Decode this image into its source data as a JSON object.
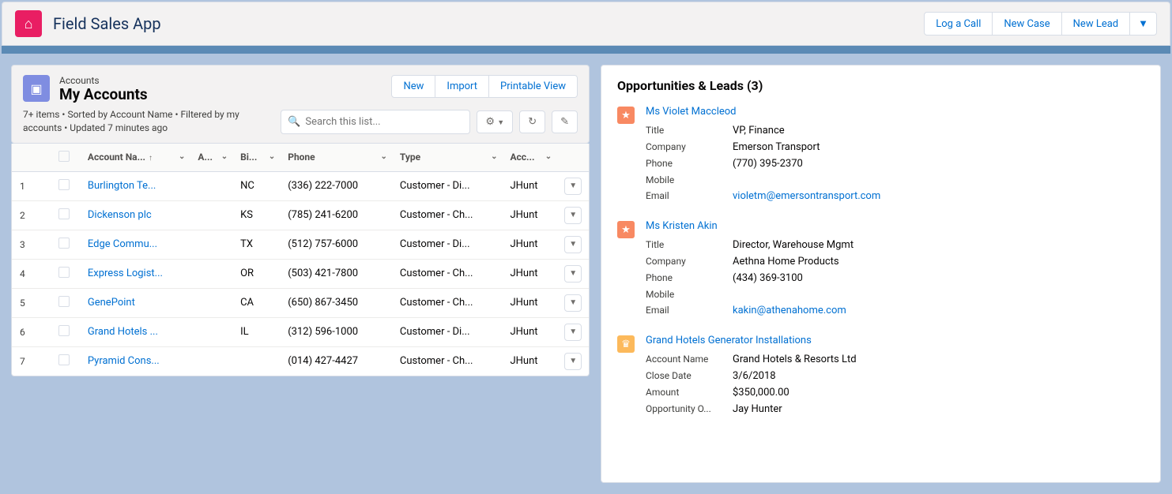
{
  "header": {
    "app_title": "Field Sales App",
    "actions": [
      "Log a Call",
      "New Case",
      "New Lead"
    ]
  },
  "accounts": {
    "object_label": "Accounts",
    "view_title": "My Accounts",
    "meta": "7+ items • Sorted by Account Name • Filtered by my accounts • Updated 7 minutes ago",
    "actions": [
      "New",
      "Import",
      "Printable View"
    ],
    "search_placeholder": "Search this list...",
    "columns": [
      "Account Na...",
      "A...",
      "Bi...",
      "Phone",
      "Type",
      "Acc..."
    ],
    "rows": [
      {
        "n": "1",
        "name": "Burlington Te...",
        "a": "",
        "state": "NC",
        "phone": "(336) 222-7000",
        "type": "Customer - Di...",
        "owner": "JHunt"
      },
      {
        "n": "2",
        "name": "Dickenson plc",
        "a": "",
        "state": "KS",
        "phone": "(785) 241-6200",
        "type": "Customer - Ch...",
        "owner": "JHunt"
      },
      {
        "n": "3",
        "name": "Edge Commu...",
        "a": "",
        "state": "TX",
        "phone": "(512) 757-6000",
        "type": "Customer - Di...",
        "owner": "JHunt"
      },
      {
        "n": "4",
        "name": "Express Logist...",
        "a": "",
        "state": "OR",
        "phone": "(503) 421-7800",
        "type": "Customer - Ch...",
        "owner": "JHunt"
      },
      {
        "n": "5",
        "name": "GenePoint",
        "a": "",
        "state": "CA",
        "phone": "(650) 867-3450",
        "type": "Customer - Ch...",
        "owner": "JHunt"
      },
      {
        "n": "6",
        "name": "Grand Hotels ...",
        "a": "",
        "state": "IL",
        "phone": "(312) 596-1000",
        "type": "Customer - Di...",
        "owner": "JHunt"
      },
      {
        "n": "7",
        "name": "Pyramid Cons...",
        "a": "",
        "state": "",
        "phone": "(014) 427-4427",
        "type": "Customer - Ch...",
        "owner": "JHunt"
      }
    ]
  },
  "right": {
    "title": "Opportunities & Leads (3)",
    "items": [
      {
        "kind": "lead",
        "title": "Ms Violet Maccleod",
        "fields": [
          {
            "label": "Title",
            "value": "VP, Finance"
          },
          {
            "label": "Company",
            "value": "Emerson Transport"
          },
          {
            "label": "Phone",
            "value": "(770) 395-2370"
          },
          {
            "label": "Mobile",
            "value": ""
          },
          {
            "label": "Email",
            "value": "violetm@emersontransport.com",
            "link": true
          }
        ]
      },
      {
        "kind": "lead",
        "title": "Ms Kristen Akin",
        "fields": [
          {
            "label": "Title",
            "value": "Director, Warehouse Mgmt"
          },
          {
            "label": "Company",
            "value": "Aethna Home Products"
          },
          {
            "label": "Phone",
            "value": "(434) 369-3100"
          },
          {
            "label": "Mobile",
            "value": ""
          },
          {
            "label": "Email",
            "value": "kakin@athenahome.com",
            "link": true
          }
        ]
      },
      {
        "kind": "opportunity",
        "title": "Grand Hotels Generator Installations",
        "fields": [
          {
            "label": "Account Name",
            "value": "Grand Hotels & Resorts Ltd"
          },
          {
            "label": "Close Date",
            "value": "3/6/2018"
          },
          {
            "label": "Amount",
            "value": "$350,000.00"
          },
          {
            "label": "Opportunity O...",
            "value": "Jay Hunter"
          }
        ]
      }
    ]
  }
}
